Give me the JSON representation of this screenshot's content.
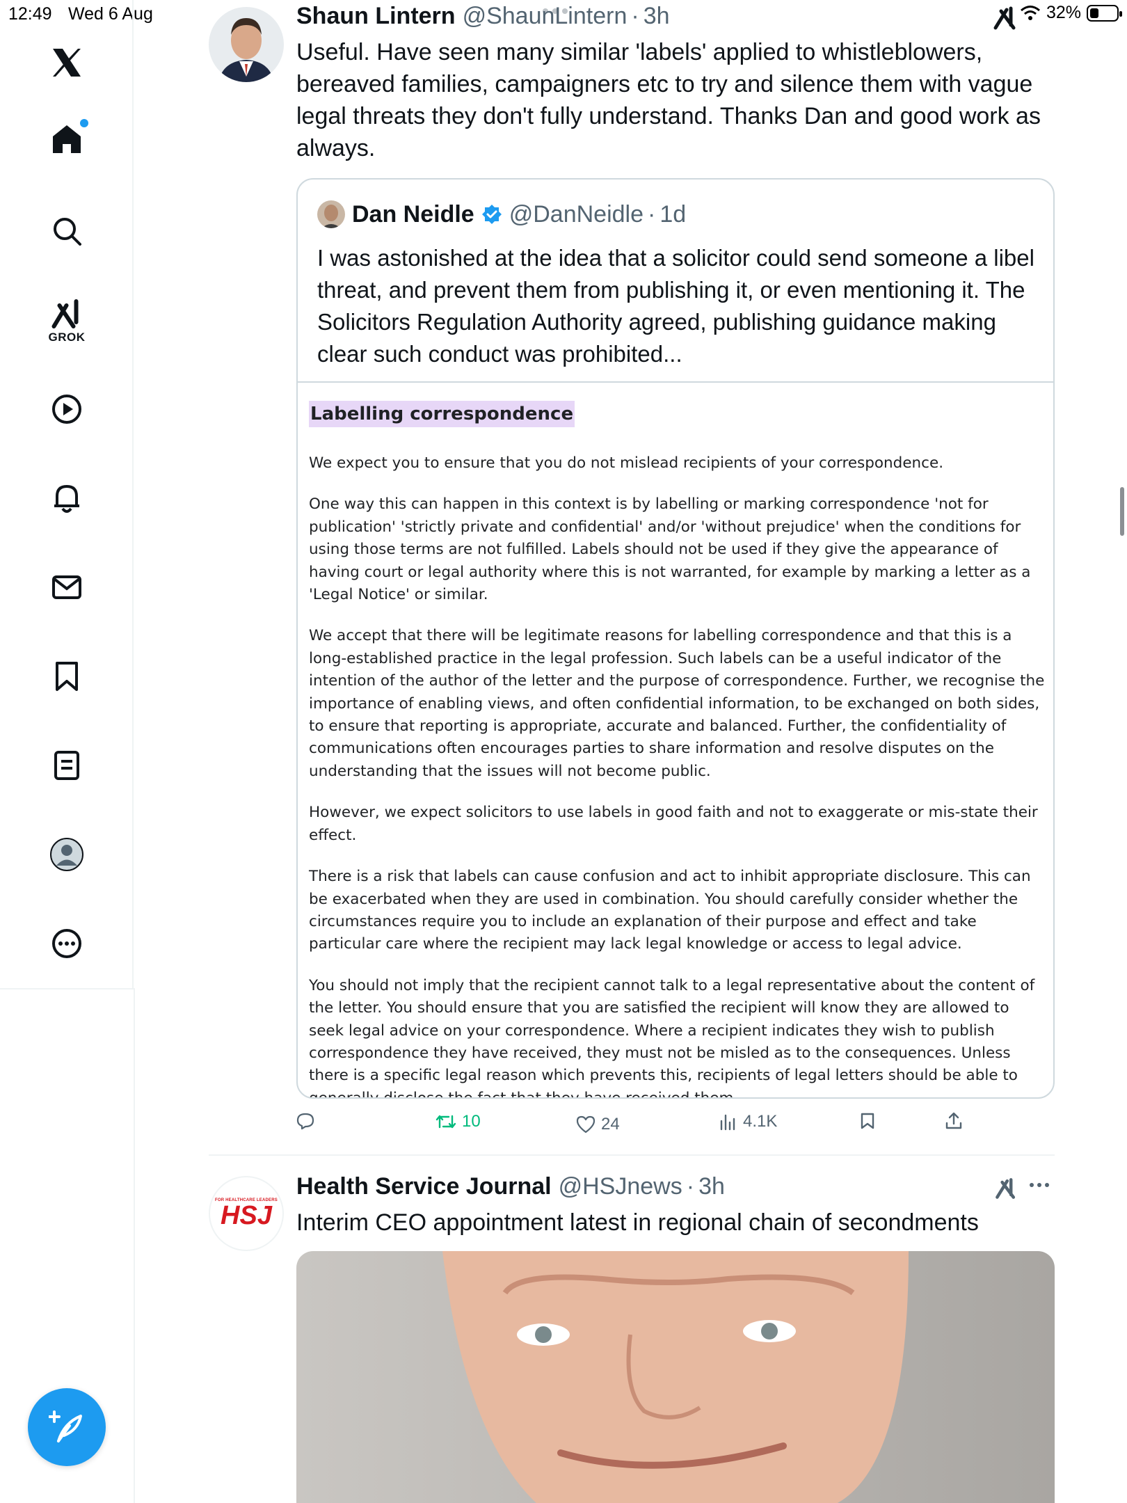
{
  "status_bar": {
    "time": "12:49",
    "date": "Wed 6 Aug",
    "battery": "32%",
    "battery_level": 0.32
  },
  "sidebar": {
    "items": [
      {
        "name": "x-logo"
      },
      {
        "name": "home",
        "has_notification": true
      },
      {
        "name": "search"
      },
      {
        "name": "grok",
        "label": "GROK"
      },
      {
        "name": "video"
      },
      {
        "name": "notifications"
      },
      {
        "name": "messages"
      },
      {
        "name": "bookmarks"
      },
      {
        "name": "lists"
      },
      {
        "name": "profile"
      },
      {
        "name": "more"
      }
    ],
    "compose_icon": "feather-plus-icon"
  },
  "tweet1": {
    "name": "Shaun Lintern",
    "handle": "@ShaunLintern",
    "sep": "·",
    "time": "3h",
    "text": "Useful. Have seen many similar 'labels' applied to whistleblowers, bereaved families, campaigners etc to try and silence them with vague legal threats they don't fully understand. Thanks Dan and good work as always.",
    "quote": {
      "name": "Dan Neidle",
      "handle": "@DanNeidle",
      "sep": "·",
      "time": "1d",
      "text": "I was astonished at the idea that a solicitor could send someone a libel threat, and prevent them from publishing it, or even mentioning it. The Solicitors Regulation Authority agreed, publishing guidance making clear such conduct was prohibited...",
      "doc_title": "Labelling correspondence",
      "doc_paragraphs": [
        "We expect you to ensure that you do not mislead recipients of your correspondence.",
        "One way this can happen in this context is by labelling or marking correspondence 'not for publication' 'strictly private and confidential' and/or 'without prejudice' when the conditions for using those terms are not fulfilled. Labels should not be used if they give the appearance of having court or legal authority where this is not warranted, for example by marking a letter as a 'Legal Notice' or similar.",
        "We accept that there will be legitimate reasons for labelling correspondence and that this is a long-established practice in the legal profession. Such labels can be a useful indicator of the intention of the author of the letter and the purpose of correspondence. Further, we recognise the importance of enabling views, and often confidential information, to be exchanged on both sides, to ensure that reporting is appropriate, accurate and balanced. Further, the confidentiality of communications often encourages parties to share information and resolve disputes on the understanding that the issues will not become public.",
        "However, we expect solicitors to use labels in good faith and not to exaggerate or mis-state their effect.",
        "There is a risk that labels can cause confusion and act to inhibit appropriate disclosure. This can be exacerbated when they are used in combination. You should carefully consider whether the circumstances require you to include an explanation of their purpose and effect and take particular care where the recipient may lack legal knowledge or access to legal advice.",
        "You should not imply that the recipient cannot talk to a legal representative about the content of the letter. You should ensure that you are satisfied the recipient will know they are allowed to seek legal advice on your correspondence. Where a recipient indicates they wish to publish correspondence they have received, they must not be misled as to the consequences. Unless there is a specific legal reason which prevents this, recipients of legal letters should be able to generally disclose the fact that they have received them."
      ]
    },
    "actions": {
      "reply": "",
      "retweets": "10",
      "likes": "24",
      "views": "4.1K"
    },
    "colors": {
      "retweet_active": "#00ba7c"
    }
  },
  "tweet2": {
    "name": "Health Service Journal",
    "handle": "@HSJnews",
    "sep": "·",
    "time": "3h",
    "avatar_small": "FOR HEALTHCARE LEADERS",
    "avatar_big": "HSJ",
    "text": "Interim CEO appointment latest in regional chain of secondments"
  },
  "colors": {
    "accent": "#1d9bf0",
    "text": "#0f1419",
    "muted": "#536471",
    "doc_highlight": "#e7d7f7"
  }
}
